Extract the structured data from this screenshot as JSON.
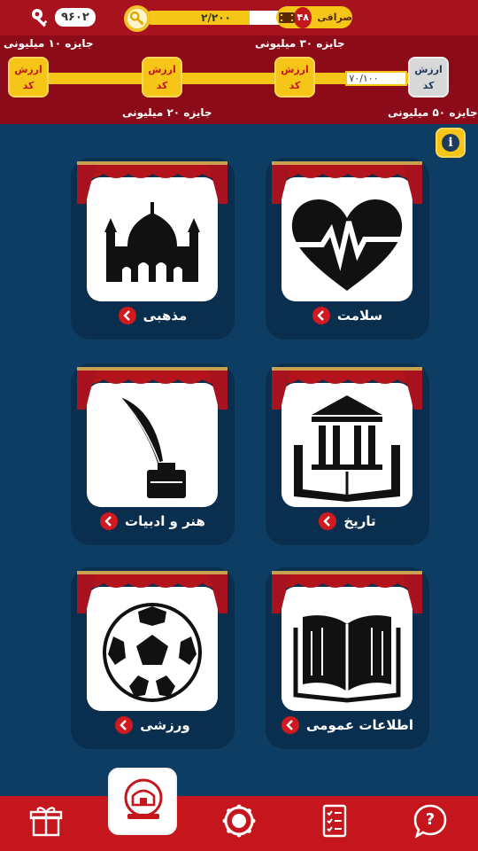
{
  "topbar": {
    "keys_count": "۹۶۰۲",
    "progress_text": "۲/۲۰۰",
    "progress_fraction": 0.74,
    "exchange_label": "صرافی",
    "exchange_count": "۴۸"
  },
  "prizes": {
    "box_line1": "ارزش",
    "box_line2": "کد",
    "progress_label": "۷۰/۱۰۰",
    "prize_10": "جایزه ۱۰ میلیونی",
    "prize_20": "جایزه ۲۰ میلیونی",
    "prize_30": "جایزه ۳۰ میلیونی",
    "prize_50": "جایزه ۵۰ میلیونی"
  },
  "info_label": "i",
  "categories": [
    {
      "label": "مذهبی",
      "icon": "mosque-icon"
    },
    {
      "label": "سلامت",
      "icon": "heart-pulse-icon"
    },
    {
      "label": "هنر و ادبیات",
      "icon": "quill-ink-icon"
    },
    {
      "label": "تاریخ",
      "icon": "museum-book-icon"
    },
    {
      "label": "ورزشی",
      "icon": "soccer-ball-icon"
    },
    {
      "label": "اطلاعات عمومی",
      "icon": "open-book-icon"
    }
  ],
  "nav": [
    {
      "icon": "gift-icon"
    },
    {
      "icon": "home-icon"
    },
    {
      "icon": "wheel-icon"
    },
    {
      "icon": "checklist-icon"
    },
    {
      "icon": "help-icon",
      "label": "?"
    }
  ],
  "colors": {
    "topbar": "#a8121f",
    "prizeband": "#8c0b18",
    "background": "#0d3d63",
    "accent": "#f5c518",
    "nav": "#c4161c"
  }
}
